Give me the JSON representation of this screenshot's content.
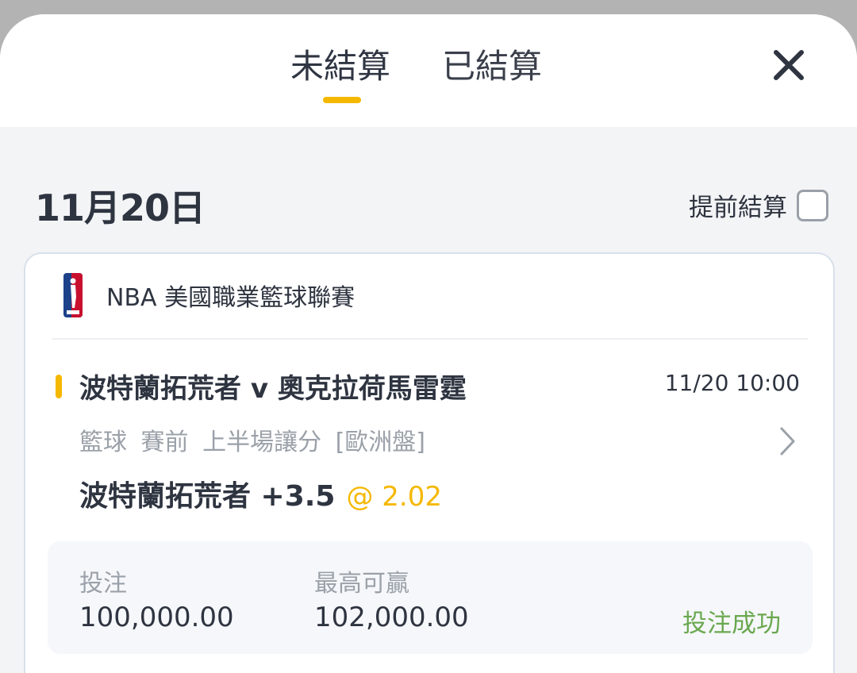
{
  "tabs": [
    {
      "label": "未結算",
      "active": true
    },
    {
      "label": "已結算",
      "active": false
    }
  ],
  "colors": {
    "accent": "#f5b800",
    "success": "#6aa84f"
  },
  "date_heading": "11月20日",
  "early_settlement": {
    "label": "提前結算",
    "checked": false
  },
  "bet": {
    "league": {
      "icon": "nba-logo-icon",
      "name": "NBA 美國職業籃球聯賽"
    },
    "match": "波特蘭拓荒者 v 奧克拉荷馬雷霆",
    "time": "11/20 10:00",
    "market": "籃球 賽前  上半場讓分 [歐洲盤]",
    "selection": "波特蘭拓荒者 +3.5",
    "odds": "@ 2.02",
    "stake_label": "投注",
    "stake_value": "100,000.00",
    "max_win_label": "最高可贏",
    "max_win_value": "102,000.00",
    "status": "投注成功"
  }
}
